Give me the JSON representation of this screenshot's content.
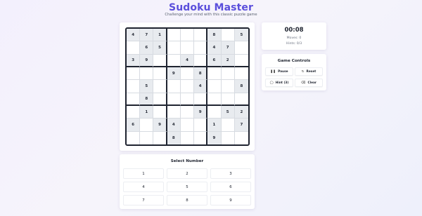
{
  "header": {
    "title": "Sudoku Master",
    "subtitle": "Challenge your mind with this classic puzzle game"
  },
  "board": {
    "rows": [
      [
        "4",
        "7",
        "1",
        "",
        "",
        "",
        "8",
        "",
        "5"
      ],
      [
        "",
        "6",
        "5",
        "",
        "",
        "",
        "4",
        "7",
        ""
      ],
      [
        "3",
        "9",
        "",
        "",
        "4",
        "",
        "6",
        "2",
        ""
      ],
      [
        "",
        "",
        "",
        "9",
        "",
        "8",
        "",
        "",
        ""
      ],
      [
        "",
        "5",
        "",
        "",
        "",
        "4",
        "",
        "",
        "8"
      ],
      [
        "",
        "8",
        "",
        "",
        "",
        "",
        "",
        "",
        ""
      ],
      [
        "",
        "1",
        "",
        "",
        "",
        "9",
        "",
        "5",
        "2"
      ],
      [
        "6",
        "",
        "9",
        "4",
        "",
        "",
        "1",
        "",
        "7"
      ],
      [
        "",
        "",
        "",
        "8",
        "",
        "",
        "9",
        "",
        ""
      ]
    ],
    "given_cell_color": "#e8ebef",
    "grid_line_color": "#1f2430"
  },
  "status": {
    "timer": "00:08",
    "moves": "Moves: 0",
    "hints": "Hints: 0/3"
  },
  "controls": {
    "title": "Game Controls",
    "buttons": [
      {
        "label": "Pause",
        "icon": "pause-icon"
      },
      {
        "label": "Reset",
        "icon": "reset-icon"
      },
      {
        "label": "Hint (3)",
        "icon": "lightbulb-icon"
      },
      {
        "label": "Clear",
        "icon": "eraser-icon"
      }
    ]
  },
  "number_pad": {
    "title": "Select Number",
    "numbers": [
      "1",
      "2",
      "3",
      "4",
      "5",
      "6",
      "7",
      "8",
      "9"
    ]
  },
  "colors": {
    "accent": "#5b4fdc",
    "background": "#f3f0fd"
  }
}
